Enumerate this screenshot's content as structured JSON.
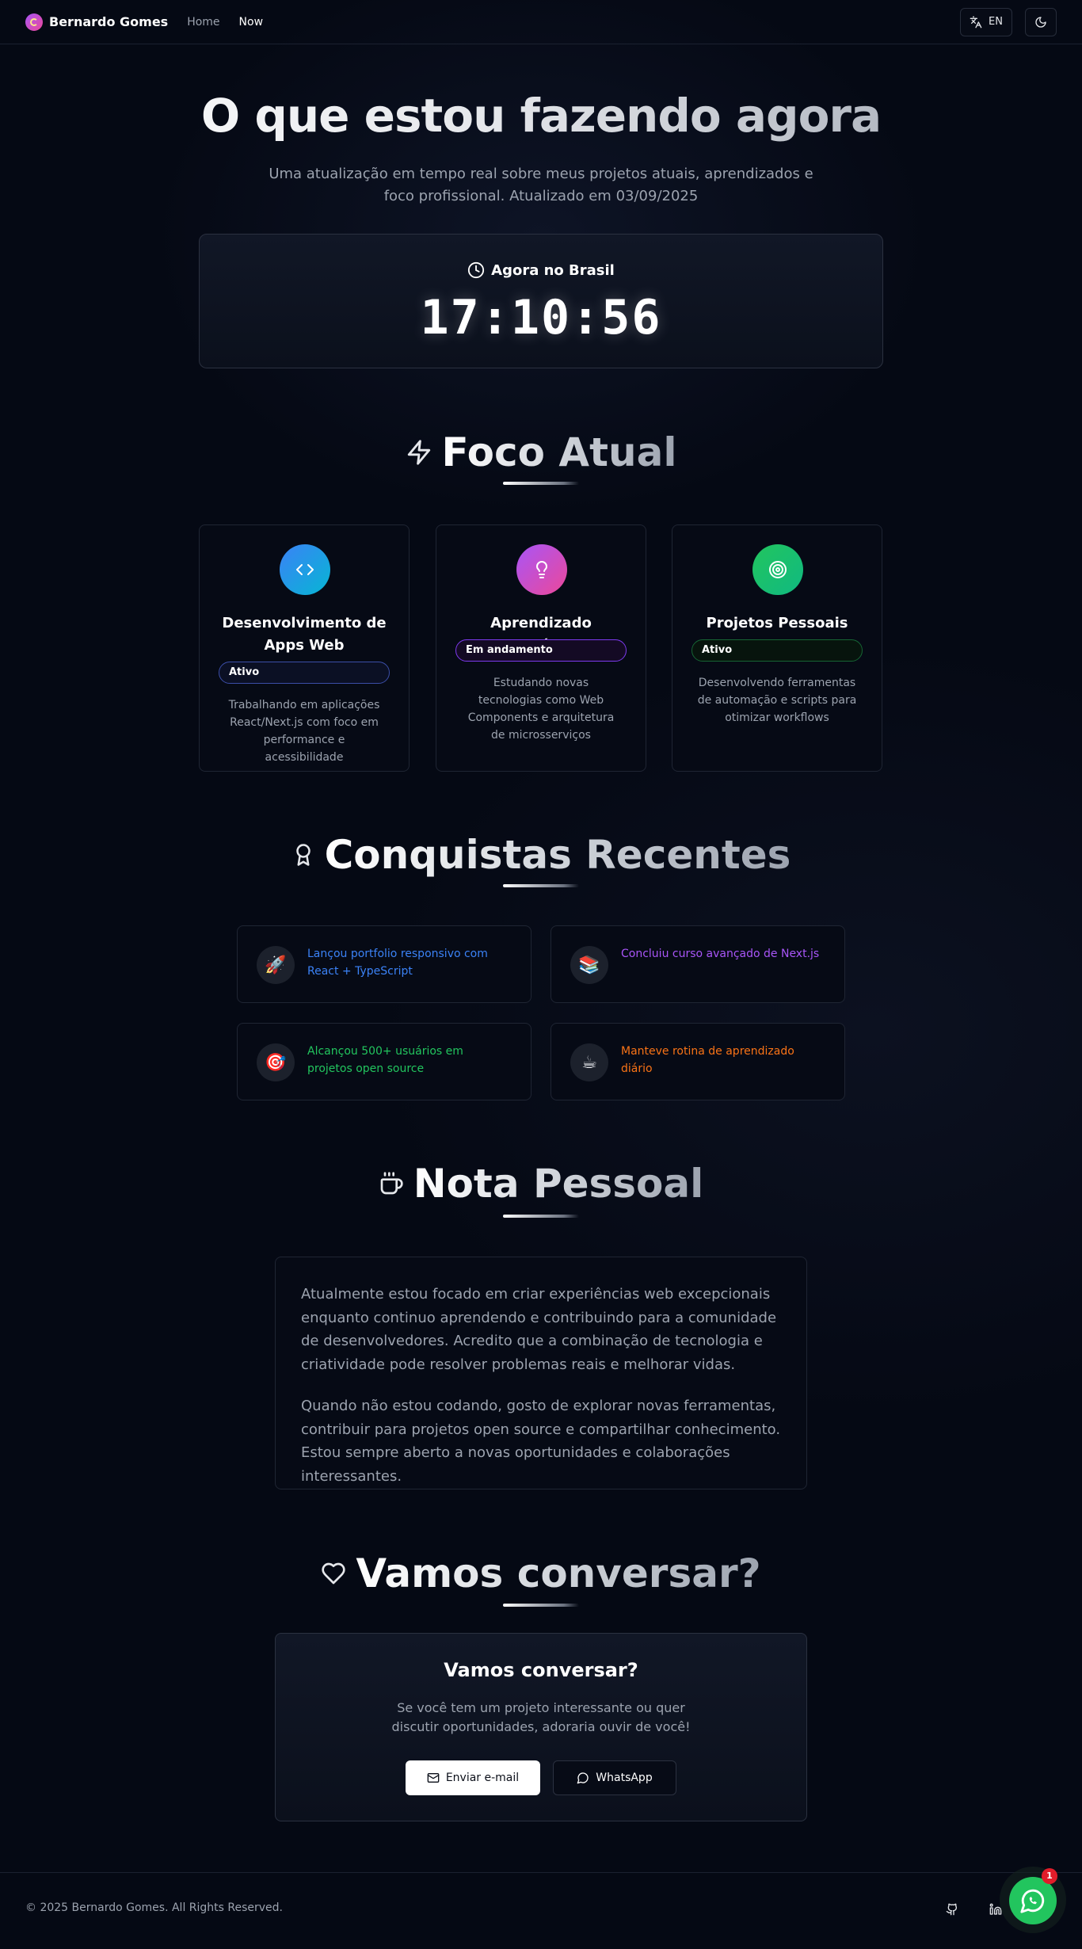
{
  "nav": {
    "brand": "Bernardo Gomes",
    "links": [
      {
        "label": "Home",
        "active": false
      },
      {
        "label": "Now",
        "active": true
      }
    ],
    "lang_label": "EN"
  },
  "hero": {
    "title": "O que estou fazendo agora",
    "subtitle": "Uma atualização em tempo real sobre meus projetos atuais, aprendizados e foco profissional. Atualizado em 03/09/2025"
  },
  "clock": {
    "label": "Agora no Brasil",
    "time": "17:10:56"
  },
  "focus": {
    "heading": "Foco Atual",
    "cards": [
      {
        "title": "Desenvolvimento de Apps Web",
        "badge": "Ativo",
        "description": "Trabalhando em aplicações React/Next.js com foco em performance e acessibilidade",
        "icon": "code-icon",
        "color": "#3b82f6"
      },
      {
        "title": "Aprendizado Contínuo",
        "badge": "Em andamento",
        "description": "Estudando novas tecnologias como Web Components e arquitetura de microsserviços",
        "icon": "lightbulb-icon",
        "color": "#c026d3"
      },
      {
        "title": "Projetos Pessoais",
        "badge": "Ativo",
        "description": "Desenvolvendo ferramentas de automação e scripts para otimizar workflows",
        "icon": "target-icon",
        "color": "#10b981"
      }
    ]
  },
  "achievements": {
    "heading": "Conquistas Recentes",
    "items": [
      {
        "emoji": "🚀",
        "text": "Lançou portfolio responsivo com React + TypeScript",
        "color": "#3b82f6"
      },
      {
        "emoji": "📚",
        "text": "Concluiu curso avançado de Next.js",
        "color": "#a855f7"
      },
      {
        "emoji": "🎯",
        "text": "Alcançou 500+ usuários em projetos open source",
        "color": "#22c55e"
      },
      {
        "emoji": "☕",
        "text": "Manteve rotina de aprendizado diário",
        "color": "#f97316"
      }
    ]
  },
  "note": {
    "heading": "Nota Pessoal",
    "paragraphs": [
      "Atualmente estou focado em criar experiências web excepcionais enquanto continuo aprendendo e contribuindo para a comunidade de desenvolvedores. Acredito que a combinação de tecnologia e criatividade pode resolver problemas reais e melhorar vidas.",
      "Quando não estou codando, gosto de explorar novas ferramentas, contribuir para projetos open source e compartilhar conhecimento. Estou sempre aberto a novas oportunidades e colaborações interessantes."
    ]
  },
  "contact": {
    "heading": "Vamos conversar?",
    "title": "Vamos conversar?",
    "subtitle": "Se você tem um projeto interessante ou quer discutir oportunidades, adoraria ouvir de você!",
    "email_label": "Enviar e-mail",
    "whatsapp_label": "WhatsApp"
  },
  "footer": {
    "copyright": "© 2025 Bernardo Gomes. All Rights Reserved."
  },
  "whatsapp_fab": {
    "count": "1"
  }
}
